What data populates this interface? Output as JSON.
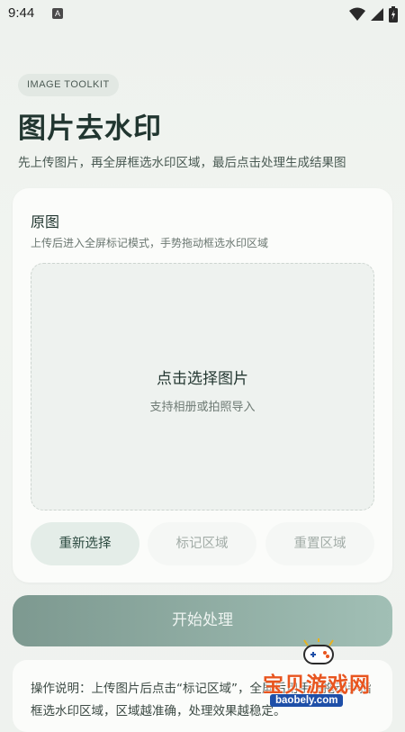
{
  "status_bar": {
    "time": "9:44",
    "notification_icon_letter": "A"
  },
  "header": {
    "badge": "IMAGE TOOLKIT",
    "title": "图片去水印",
    "subtitle": "先上传图片，再全屏框选水印区域，最后点击处理生成结果图"
  },
  "card": {
    "title": "原图",
    "hint": "上传后进入全屏标记模式，手势拖动框选水印区域",
    "dropzone": {
      "main": "点击选择图片",
      "sub": "支持相册或拍照导入"
    },
    "buttons": {
      "reselect": "重新选择",
      "mark_area": "标记区域",
      "reset_area": "重置区域"
    }
  },
  "start_button": "开始处理",
  "info": {
    "text": "操作说明：上传图片后点击“标记区域”，全屏后用手指拖动手指框选水印区域，区域越准确，处理效果越稳定。"
  },
  "watermark_overlay": {
    "text": "宝贝游戏网",
    "url": "baobely.com"
  },
  "colors": {
    "accent": "#2c4a40",
    "primary_button_start": "#7d9990",
    "primary_button_end": "#a1bfb5",
    "watermark_orange": "#e8551f"
  }
}
